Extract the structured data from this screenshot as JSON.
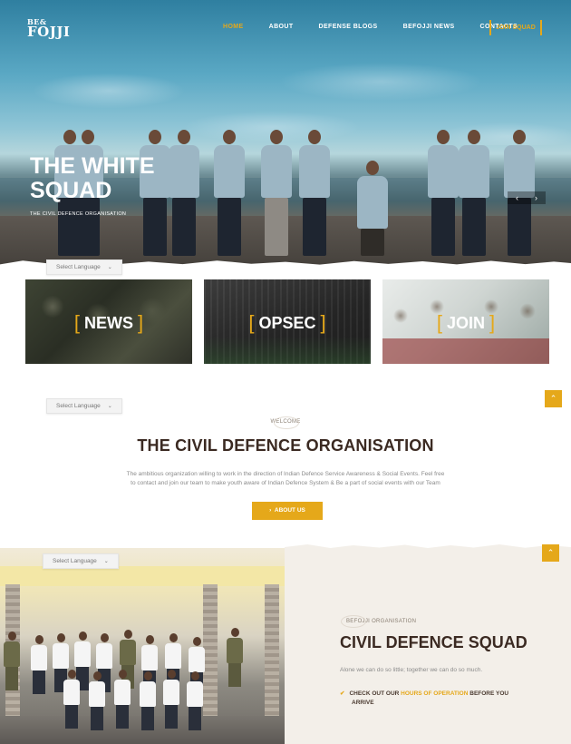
{
  "header": {
    "logo_line1": "BE&",
    "logo_line2": "FOJJI",
    "nav": [
      {
        "label": "HOME",
        "active": true
      },
      {
        "label": "ABOUT",
        "active": false
      },
      {
        "label": "DEFENSE BLOGS",
        "active": false
      },
      {
        "label": "BEFOJJI NEWS",
        "active": false
      },
      {
        "label": "CONTACTS",
        "active": false
      }
    ],
    "join_button": "JOIN SQUAD"
  },
  "hero": {
    "title_line1": "THE WHITE",
    "title_line2": "SQUAD",
    "subtitle": "THE CIVIL DEFENCE ORGANISATION",
    "prev_icon": "chevron-left-icon",
    "next_icon": "chevron-right-icon"
  },
  "language_select": {
    "label": "Select Language"
  },
  "cards": [
    {
      "label": "NEWS"
    },
    {
      "label": "OPSEC"
    },
    {
      "label": "JOIN"
    }
  ],
  "welcome": {
    "small_label": "WELCOME",
    "title": "THE CIVIL DEFENCE ORGANISATION",
    "text_line1": "The ambitious organization willing to work in the direction of Indian Defence Service Awareness & Social Events. Feel free",
    "text_line2": "to contact and join our team to make youth aware of Indian Defence System & Be a part of social events with our Team",
    "button": "ABOUT US"
  },
  "squad": {
    "small_label": "BEFOJJI ORGANISATION",
    "title": "CIVIL DEFENCE SQUAD",
    "text": "Alone we can do so little; together we can do so much.",
    "check_prefix": "CHECK OUT OUR ",
    "check_highlight": "HOURS OF OPERATION",
    "check_suffix": " BEFORE YOU",
    "check_line2": "ARRIVE"
  },
  "colors": {
    "accent": "#e5a81a",
    "heading": "#3b2a22",
    "panel": "#f3efe9"
  }
}
